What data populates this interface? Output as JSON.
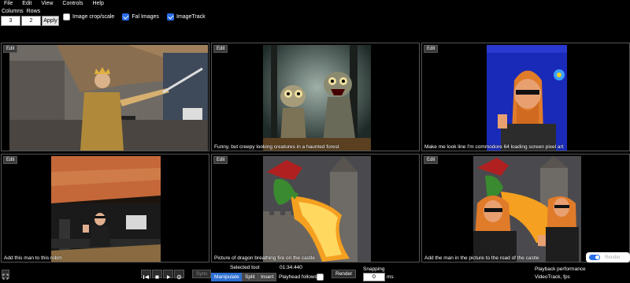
{
  "menu": [
    "File",
    "Edit",
    "View",
    "Controls",
    "Help"
  ],
  "toolbar": {
    "columns_label": "Columns",
    "rows_label": "Rows",
    "columns_value": "3",
    "rows_value": "2",
    "apply_label": "Apply",
    "checkboxes": [
      {
        "label": "Image crop/scale",
        "checked": false
      },
      {
        "label": "Fal Images",
        "checked": true
      },
      {
        "label": "ImageTrack",
        "checked": true
      }
    ]
  },
  "panels": [
    {
      "edit": "Edit",
      "caption": ""
    },
    {
      "edit": "Edit",
      "caption": "Funny, but creepy looking creatures in a haunted forest"
    },
    {
      "edit": "Edit",
      "caption": "Make me look line I'm commodore 64 loading screen pixel art"
    },
    {
      "edit": "Edit",
      "caption": "Add this man to this robm"
    },
    {
      "edit": "Edit",
      "caption": "Picture of dragon breathing fire on the castle"
    },
    {
      "edit": "Edit",
      "caption": "Add the man in the picture to the road of the castle"
    }
  ],
  "bottom": {
    "sync_label": "Sync",
    "selected_tool_label": "Selected tool",
    "timecode": "01:34:440",
    "tools": [
      "Manipulate",
      "Split",
      "Insert"
    ],
    "active_tool": "Manipulate",
    "playhead_follows_label": "Playhead follows",
    "render_label": "Render",
    "snapping_label": "Snapping",
    "snapping_value": "0",
    "snapping_unit": "ms",
    "perf_label": "Playback performance",
    "perf_value": "VideoTrack, fps",
    "toggle_label": "Render"
  },
  "colors": {
    "accent": "#2a6ee8",
    "background": "#000000"
  }
}
